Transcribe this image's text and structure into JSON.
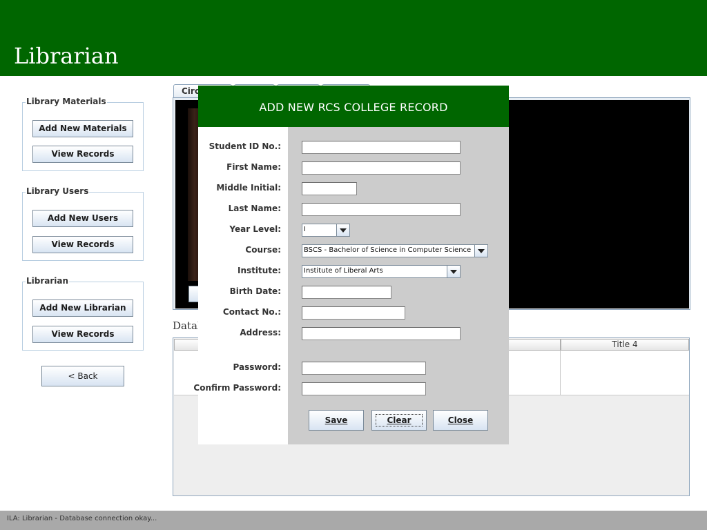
{
  "header": {
    "title": "Librarian"
  },
  "sidebar": {
    "groups": [
      {
        "title": "Library Materials",
        "buttons": [
          "Add New Materials",
          "View Records"
        ]
      },
      {
        "title": "Library Users",
        "buttons": [
          "Add New Users",
          "View Records"
        ]
      },
      {
        "title": "Librarian",
        "buttons": [
          "Add New Librarian",
          "View Records"
        ]
      }
    ],
    "back": "< Back"
  },
  "tabs": {
    "first_label": "Circu"
  },
  "database": {
    "label": "Datal"
  },
  "table": {
    "visible_header": "Title 4"
  },
  "dialog": {
    "title": "ADD NEW RCS COLLEGE RECORD",
    "labels": {
      "student_id": "Student ID No.:",
      "first_name": "First Name:",
      "middle_initial": "Middle Initial:",
      "last_name": "Last Name:",
      "year_level": "Year Level:",
      "course": "Course:",
      "institute": "Institute:",
      "birth_date": "Birth Date:",
      "contact": "Contact No.:",
      "address": "Address:",
      "password": "Password:",
      "confirm_password": "Confirm Password:"
    },
    "values": {
      "year_level": "I",
      "course": "BSCS - Bachelor of Science in Computer Science",
      "institute": "Institute of Liberal Arts"
    },
    "buttons": {
      "save": "Save",
      "clear": "Clear",
      "close": "Close"
    }
  },
  "status": {
    "text": "ILA: Librarian - Database connection okay..."
  }
}
